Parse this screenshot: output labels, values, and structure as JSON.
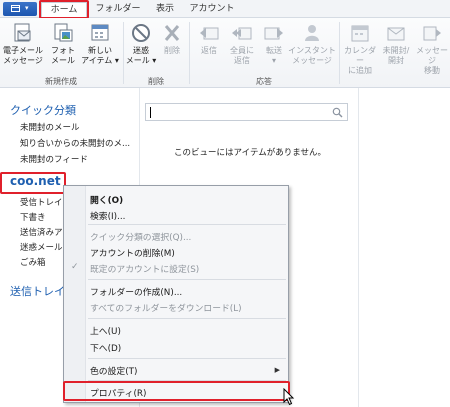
{
  "tabs": [
    {
      "label": "ホーム",
      "active": true
    },
    {
      "label": "フォルダー",
      "active": false
    },
    {
      "label": "表示",
      "active": false
    },
    {
      "label": "アカウント",
      "active": false
    }
  ],
  "ribbon": {
    "new_group": {
      "label": "新規作成",
      "buttons": [
        {
          "line1": "電子メール",
          "line2": "メッセージ",
          "icon": "new-email-icon"
        },
        {
          "line1": "フォト",
          "line2": "メール",
          "icon": "photo-mail-icon"
        },
        {
          "line1": "新しい",
          "line2": "アイテム ▾",
          "icon": "new-item-icon"
        }
      ]
    },
    "delete_group": {
      "label": "削除",
      "buttons": [
        {
          "line1": "迷惑",
          "line2": "メール ▾",
          "icon": "junk-icon",
          "disabled": false
        },
        {
          "line1": "削除",
          "line2": "",
          "icon": "delete-x-icon",
          "disabled": true
        }
      ]
    },
    "respond_group": {
      "label": "応答",
      "buttons": [
        {
          "line1": "返信",
          "line2": "",
          "icon": "reply-icon"
        },
        {
          "line1": "全員に",
          "line2": "返信",
          "icon": "reply-all-icon"
        },
        {
          "line1": "転送",
          "line2": "▾",
          "icon": "forward-icon"
        },
        {
          "line1": "インスタント",
          "line2": "メッセージ",
          "icon": "instant-message-icon"
        }
      ]
    },
    "actions_group": {
      "buttons": [
        {
          "line1": "カレンダー",
          "line2": "に追加",
          "icon": "calendar-icon"
        },
        {
          "line1": "未開封/",
          "line2": "開封",
          "icon": "unread-icon"
        },
        {
          "line1": "メッセージ",
          "line2": "移動",
          "icon": "move-icon"
        }
      ]
    }
  },
  "nav": {
    "quick_header": "クイック分類",
    "quick_items": [
      "未開封のメール",
      "知り合いからの未開封のメ...",
      "未開封のフィード"
    ],
    "account": "coo.net",
    "account_items": [
      "受信トレイ",
      "下書き",
      "送信済みア",
      "迷惑メール",
      "ごみ箱"
    ],
    "outbox": "送信トレイ"
  },
  "main": {
    "search_placeholder": "",
    "empty_message": "このビューにはアイテムがありません。"
  },
  "context_menu": {
    "items": [
      {
        "label": "開く(O)",
        "bold": true,
        "disabled": false
      },
      {
        "label": "検索(I)...",
        "bold": false,
        "disabled": false
      },
      {
        "label": "クイック分類の選択(Q)...",
        "bold": false,
        "disabled": true
      },
      {
        "label": "アカウントの削除(M)",
        "bold": false,
        "disabled": false
      },
      {
        "label": "既定のアカウントに設定(S)",
        "bold": false,
        "disabled": true,
        "checked": true
      },
      {
        "label": "フォルダーの作成(N)...",
        "bold": false,
        "disabled": false
      },
      {
        "label": "すべてのフォルダーをダウンロード(L)",
        "bold": false,
        "disabled": true
      },
      {
        "label": "上へ(U)",
        "bold": false,
        "disabled": false
      },
      {
        "label": "下へ(D)",
        "bold": false,
        "disabled": false
      },
      {
        "label": "色の設定(T)",
        "bold": false,
        "disabled": false,
        "submenu": true
      },
      {
        "label": "プロパティ(R)",
        "bold": false,
        "disabled": false
      }
    ],
    "check_glyph": "✓",
    "submenu_glyph": "▶"
  },
  "colors": {
    "highlight_red": "#e0202b",
    "accent_blue": "#1e5fb0"
  }
}
